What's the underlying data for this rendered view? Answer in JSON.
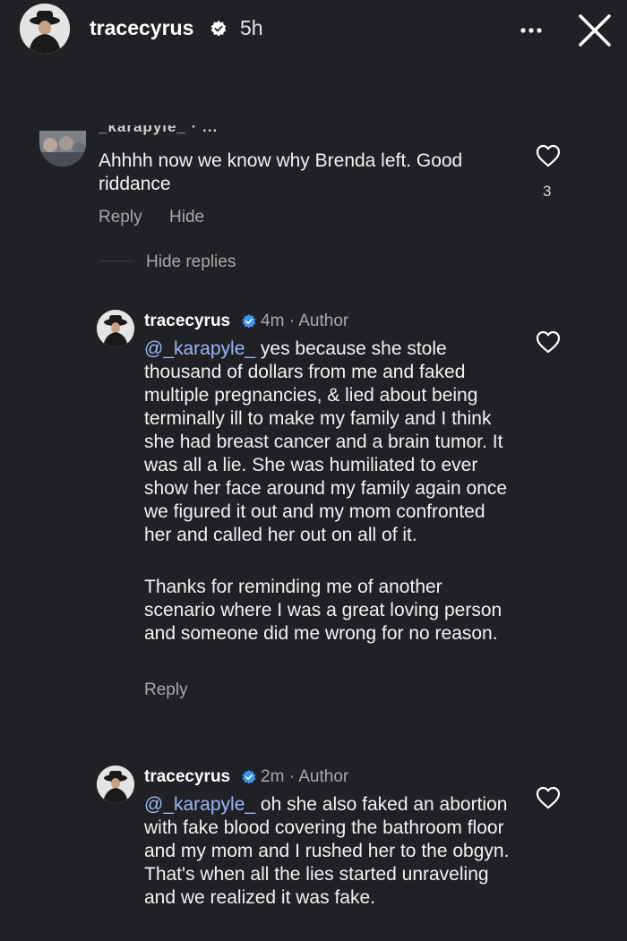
{
  "header": {
    "username": "tracecyrus",
    "time": "5h",
    "more_icon": "more-horizontal-icon",
    "close_icon": "close-x-icon"
  },
  "comment": {
    "author_cut": "_karapyle_ · ...",
    "text": "Ahhhh now we know why Brenda left. Good riddance",
    "likes": "3",
    "reply_label": "Reply",
    "hide_label": "Hide",
    "hide_replies_label": "Hide replies"
  },
  "replies": [
    {
      "username": "tracecyrus",
      "time": "4m",
      "separator": "·",
      "role": "Author",
      "mention": "@_karapyle_",
      "text_line1": " yes because she stole thousand of dollars from me and faked multiple pregnancies, & lied about being terminally ill  to make my family and I think she had breast cancer and a brain tumor. It was all a lie. She was humiliated to ever show her face around my family again once we figured it out and my mom confronted her and called her out on all of it.",
      "text_para2": "Thanks for reminding me of another scenario where I was a great loving person and someone did me wrong for no reason.",
      "reply_label": "Reply"
    },
    {
      "username": "tracecyrus",
      "time": "2m",
      "separator": "·",
      "role": "Author",
      "mention": "@_karapyle_",
      "text_line1": " oh she also faked an abortion with fake blood covering the bathroom floor and my mom and I rushed her to the obgyn. That's when all the lies started unraveling and we realized it was fake."
    }
  ],
  "colors": {
    "background": "#1f2125",
    "mention": "#9db7f5",
    "verified": "#3897f0",
    "muted": "#a8a8a8"
  }
}
